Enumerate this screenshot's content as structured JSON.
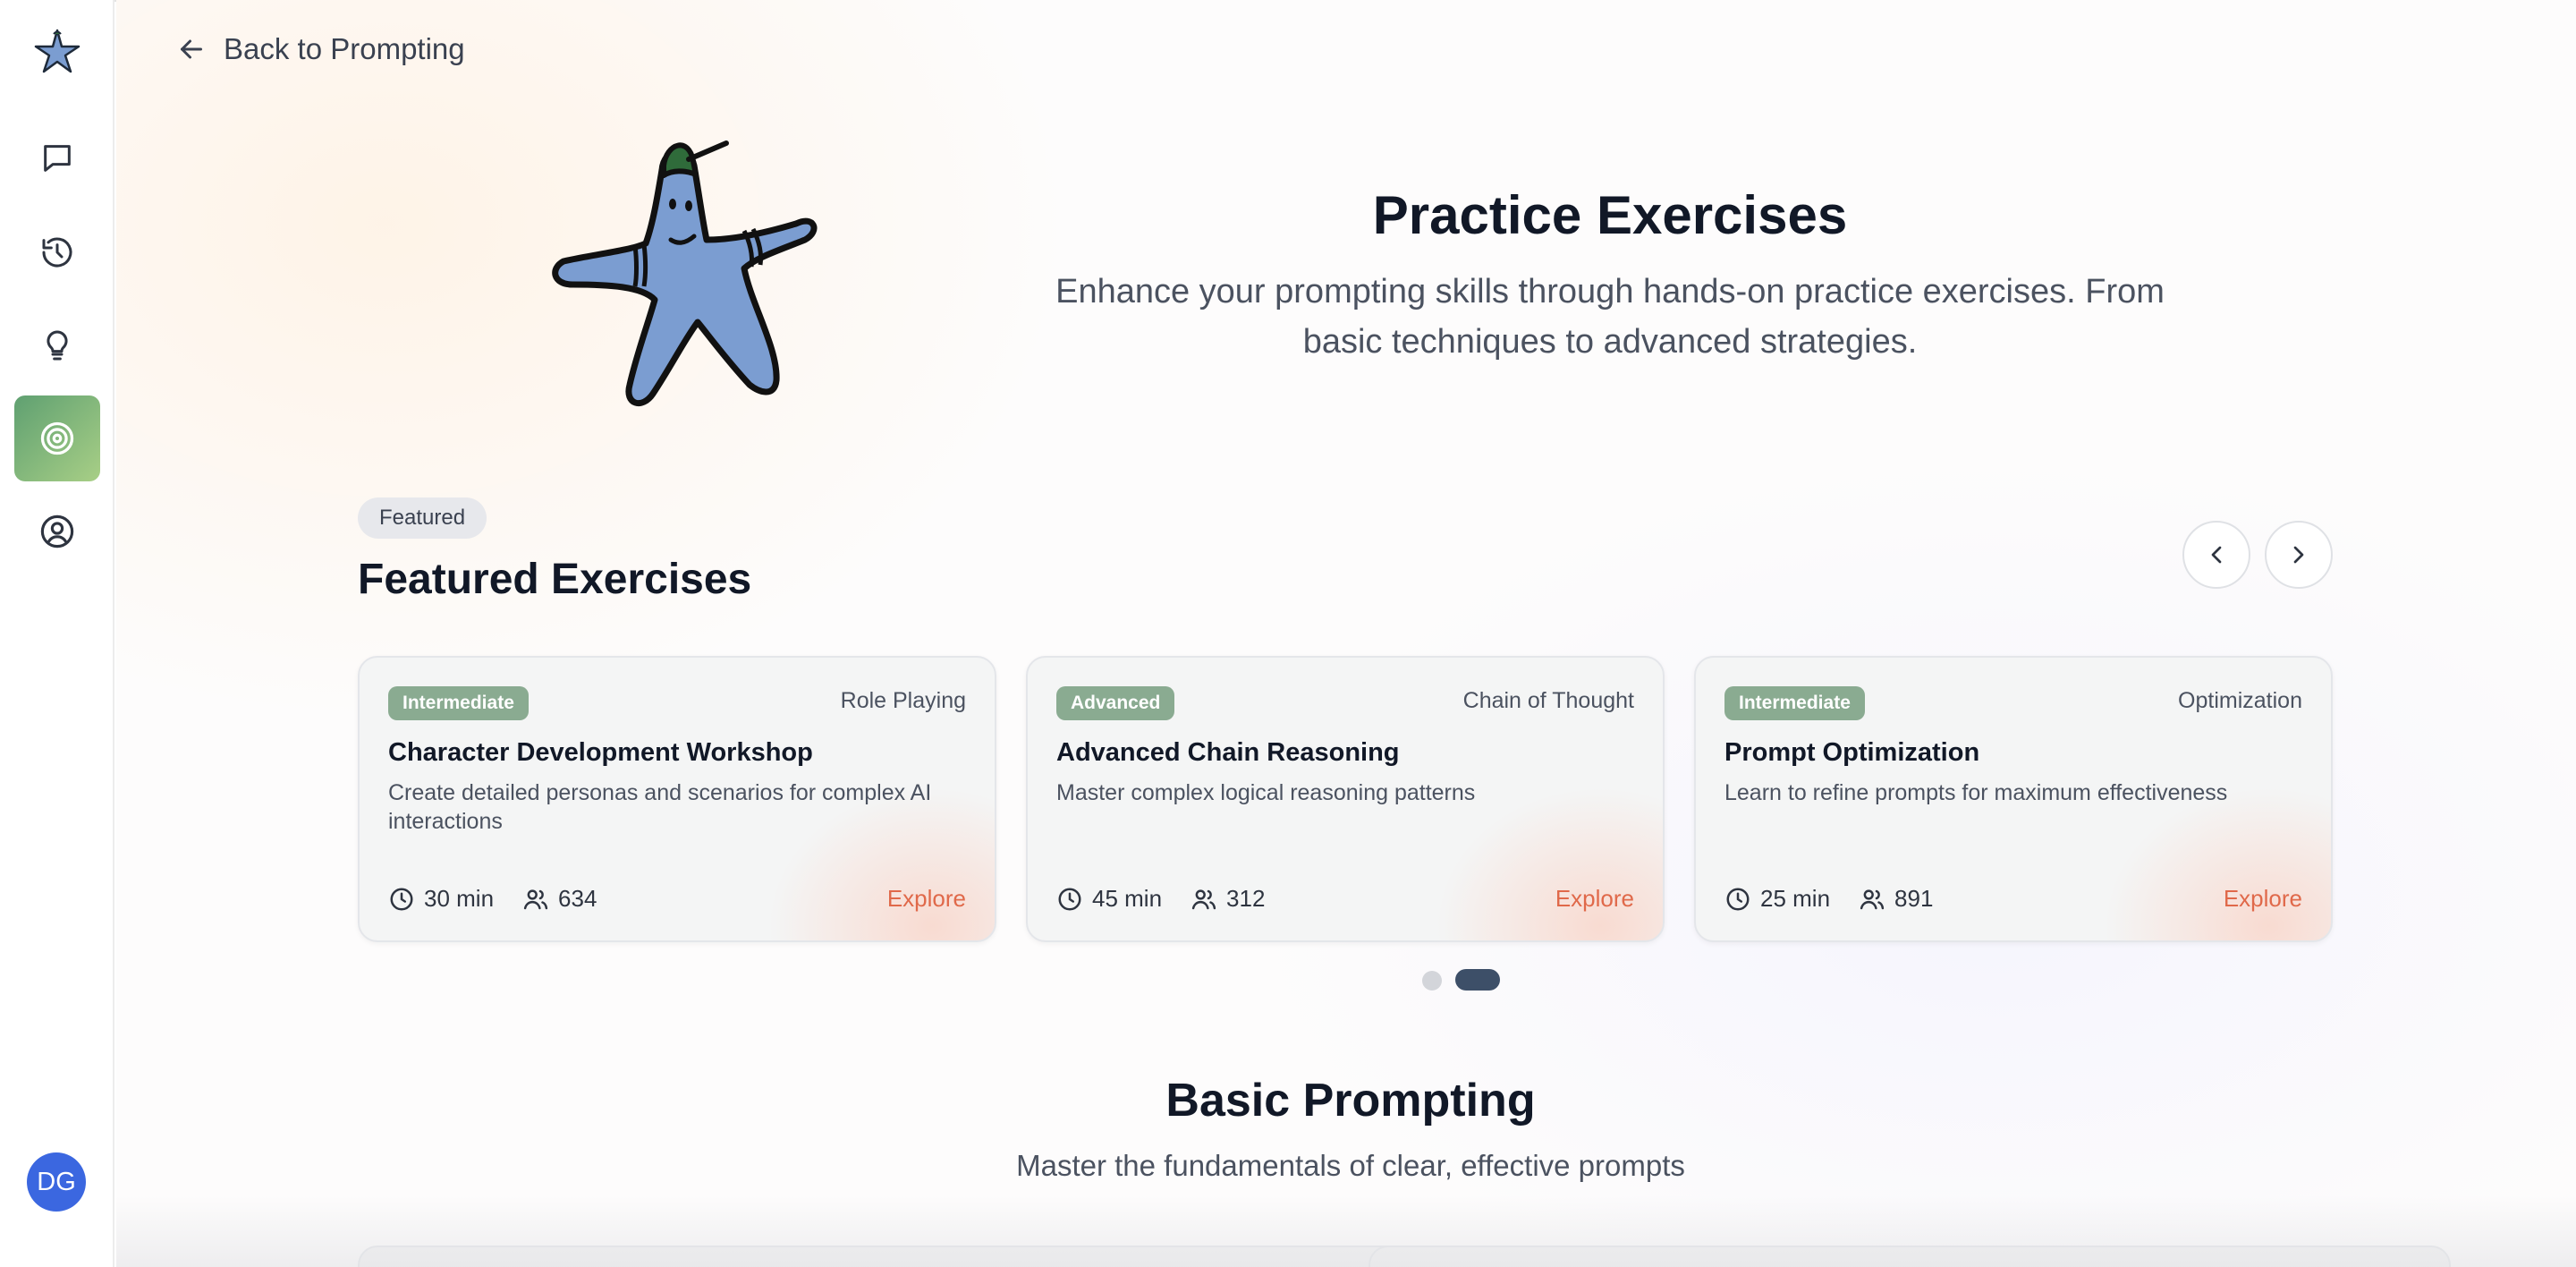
{
  "sidebar": {
    "items": [
      {
        "name": "logo-icon"
      },
      {
        "name": "chat-icon"
      },
      {
        "name": "history-icon"
      },
      {
        "name": "lightbulb-icon"
      },
      {
        "name": "target-icon",
        "active": true
      },
      {
        "name": "profile-icon"
      }
    ],
    "avatar_initials": "DG"
  },
  "header": {
    "back_label": "Back to Prompting"
  },
  "hero": {
    "title": "Practice Exercises",
    "subtitle": "Enhance your prompting skills through hands-on practice exercises. From basic techniques to advanced strategies."
  },
  "featured": {
    "tag": "Featured",
    "title": "Featured Exercises",
    "cards": [
      {
        "level": "Intermediate",
        "category": "Role Playing",
        "title": "Character Development Workshop",
        "description": "Create detailed personas and scenarios for complex AI interactions",
        "duration": "30 min",
        "participants": "634",
        "action": "Explore"
      },
      {
        "level": "Advanced",
        "category": "Chain of Thought",
        "title": "Advanced Chain Reasoning",
        "description": "Master complex logical reasoning patterns",
        "duration": "45 min",
        "participants": "312",
        "action": "Explore"
      },
      {
        "level": "Intermediate",
        "category": "Optimization",
        "title": "Prompt Optimization",
        "description": "Learn to refine prompts for maximum effectiveness",
        "duration": "25 min",
        "participants": "891",
        "action": "Explore"
      }
    ],
    "pagination": {
      "pages": 2,
      "current": 2
    }
  },
  "basic": {
    "title": "Basic Prompting",
    "subtitle": "Master the fundamentals of clear, effective prompts"
  },
  "colors": {
    "accent": "#e0694a",
    "level_badge": "#8aab91",
    "active_nav_start": "#5fa071",
    "active_nav_end": "#a8cf86",
    "avatar": "#3b67e0",
    "star_body": "#7b9dd1",
    "star_cap": "#2f6b3a"
  }
}
